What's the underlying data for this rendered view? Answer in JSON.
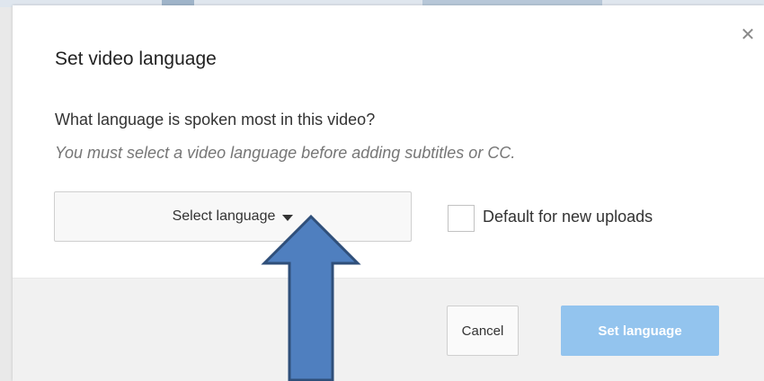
{
  "dialog": {
    "title": "Set video language",
    "question": "What language is spoken most in this video?",
    "hint": "You must select a video language before adding subtitles or CC.",
    "close_icon": "close-icon"
  },
  "language_select": {
    "label": "Select language",
    "icon": "caret-down-icon"
  },
  "default_checkbox": {
    "label": "Default for new uploads",
    "checked": false
  },
  "footer": {
    "cancel_label": "Cancel",
    "set_label": "Set language"
  },
  "annotation": {
    "icon": "up-arrow-icon",
    "color": "#4f7fbf"
  },
  "colors": {
    "primary_disabled": "#93c4ee",
    "footer_bg": "#f1f1f1"
  }
}
